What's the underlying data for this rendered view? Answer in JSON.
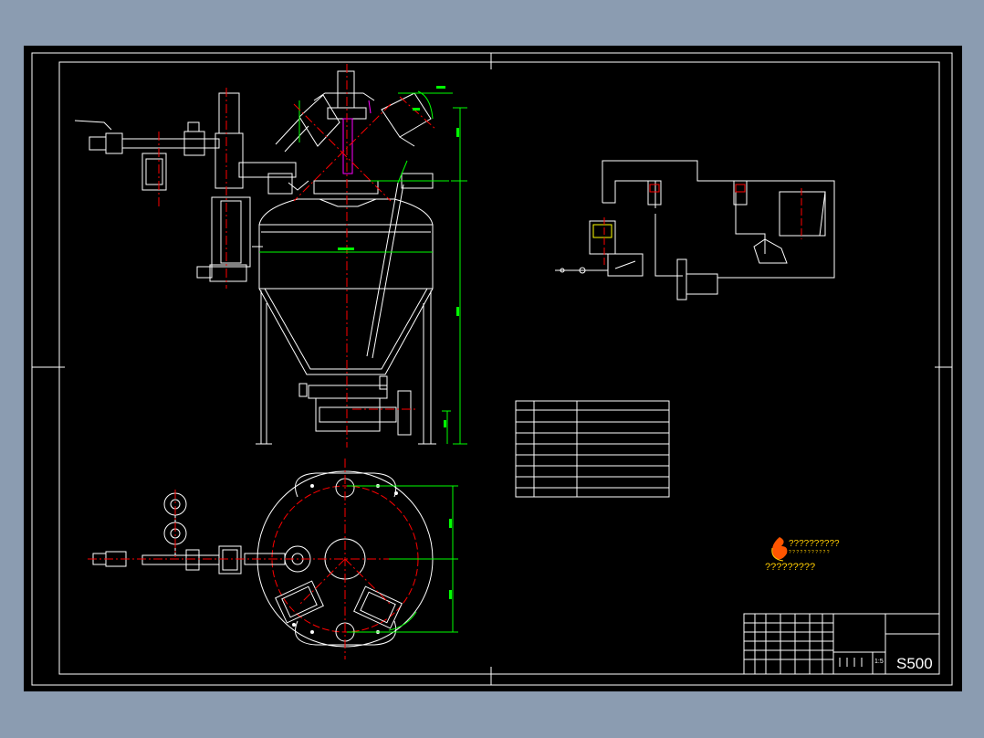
{
  "drawing": {
    "number": "S500",
    "scale": "1:5",
    "logo_line1": "??????????",
    "logo_line2": "? ? ? ? ? ? ? ? ? ? ?",
    "logo_caption": "?????????"
  },
  "colors": {
    "window": "#8b9cb1",
    "canvas": "#000000",
    "line": "#ffffff",
    "centerline": "#ff0000",
    "dimension": "#00ff00",
    "accent": "#ff00ff",
    "logo_text": "#ffcc00",
    "logo_flame": "#ff5500"
  }
}
